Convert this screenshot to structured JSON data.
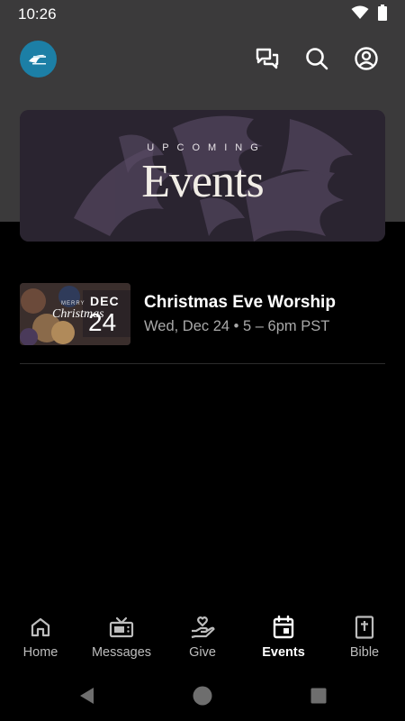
{
  "status_bar": {
    "time": "10:26"
  },
  "header": {
    "icons": [
      "chat-icon",
      "search-icon",
      "account-icon"
    ]
  },
  "banner": {
    "subtitle": "UPCOMING",
    "title": "Events"
  },
  "events": [
    {
      "title": "Christmas Eve Worship",
      "date": "Wed, Dec 24 • 5 – 6pm PST",
      "thumb_month": "DEC",
      "thumb_day": "24",
      "thumb_script": "Christmas",
      "thumb_small": "MERRY"
    }
  ],
  "bottom_nav": {
    "active": "Events",
    "items": [
      {
        "label": "Home",
        "icon": "home-icon"
      },
      {
        "label": "Messages",
        "icon": "tv-icon"
      },
      {
        "label": "Give",
        "icon": "give-hand-icon"
      },
      {
        "label": "Events",
        "icon": "calendar-icon"
      },
      {
        "label": "Bible",
        "icon": "bible-icon"
      }
    ]
  },
  "colors": {
    "top_background": "#3b3a3b",
    "body_background": "#000000",
    "logo": "#1c7fa6",
    "secondary_text": "#a9a9a9"
  }
}
